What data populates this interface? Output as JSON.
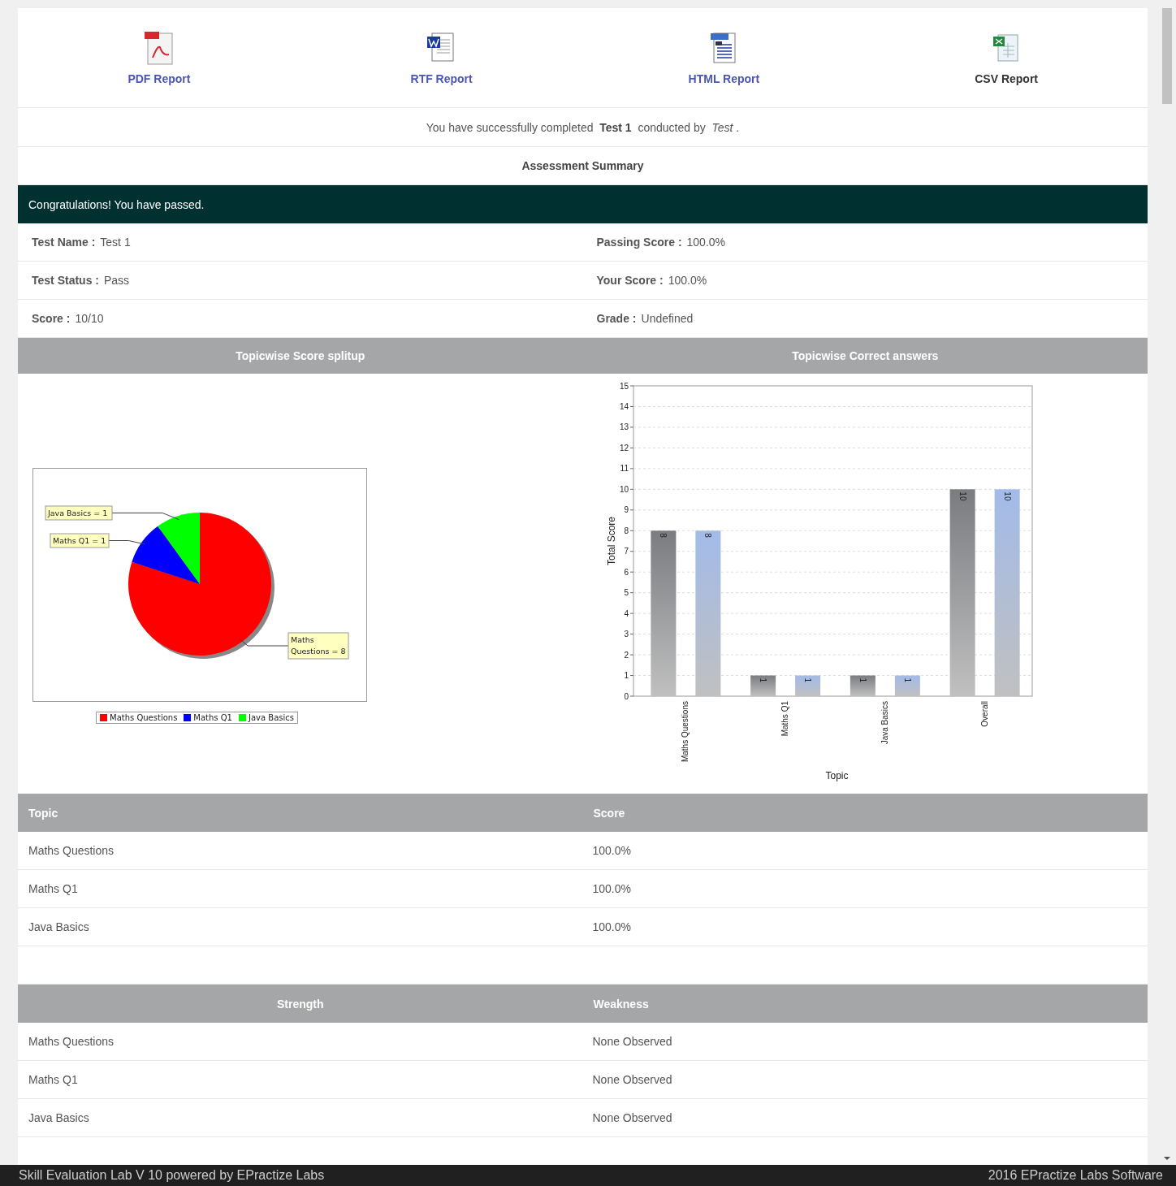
{
  "reports": [
    {
      "kind": "pdf",
      "label": "PDF Report",
      "color": "#4b55b5"
    },
    {
      "kind": "rtf",
      "label": "RTF Report",
      "color": "#4b55b5"
    },
    {
      "kind": "html",
      "label": "HTML Report",
      "color": "#4b55b5"
    },
    {
      "kind": "csv",
      "label": "CSV Report",
      "color": "#333333"
    }
  ],
  "message": "You have successfully completed  **Test 1**  conducted by  *Test* .",
  "summary_title": "Assessment Summary",
  "banner": "Congratulations! You have passed.",
  "details": [
    {
      "label": "Test Name :",
      "value": "Test 1"
    },
    {
      "label": "Passing Score :",
      "value": "100.0%"
    },
    {
      "label": "Test Status :",
      "value": "Pass"
    },
    {
      "label": "Your Score :",
      "value": "100.0%"
    },
    {
      "label": "Score :",
      "value": "10/10"
    },
    {
      "label": "Grade :",
      "value": "Undefined"
    }
  ],
  "charts": [
    {
      "title": "Topicwise Score splitup",
      "chart_data": {
        "type": "pie",
        "categories": [
          "Maths Questions",
          "Maths Q1",
          "Java Basics"
        ],
        "values": [
          8,
          1,
          1
        ],
        "colors": [
          "#ff0000",
          "#0000ff",
          "#00ff00"
        ],
        "value_labels": [
          "Maths Questions = 8",
          "Maths Q1 = 1",
          "Java Basics = 1"
        ],
        "legend": "bottom"
      }
    },
    {
      "title": "Topicwise Correct answers",
      "chart_data": {
        "type": "bar",
        "xlabel": "Topic",
        "ylabel": "Total Score",
        "categories": [
          "Maths Questions",
          "Maths Q1",
          "Java Basics",
          "Overall"
        ],
        "series": [
          {
            "color": "#7a7c80",
            "values": [
              8,
              1,
              1,
              10
            ]
          },
          {
            "color": "#a2bbe8",
            "values": [
              8,
              1,
              1,
              10
            ]
          }
        ],
        "ylim": [
          0,
          15
        ],
        "yticks": [
          0,
          1,
          2,
          3,
          4,
          5,
          6,
          7,
          8,
          9,
          10,
          11,
          12,
          13,
          14,
          15
        ],
        "data_labels": true,
        "grid": true
      }
    }
  ],
  "topic_table": {
    "columns": [
      "Topic",
      "Score"
    ],
    "rows": [
      [
        "Maths Questions",
        "100.0%"
      ],
      [
        "Maths Q1",
        "100.0%"
      ],
      [
        "Java Basics",
        "100.0%"
      ]
    ]
  },
  "strength_table": {
    "columns": [
      "Strength",
      "Weakness"
    ],
    "rows": [
      [
        "Maths Questions",
        "None Observed"
      ],
      [
        "Maths Q1",
        "None Observed"
      ],
      [
        "Java Basics",
        "None Observed"
      ]
    ]
  },
  "footer": {
    "left": "Skill Evaluation Lab V 10 powered by EPractize Labs",
    "right": "2016 EPractize Labs Software"
  }
}
